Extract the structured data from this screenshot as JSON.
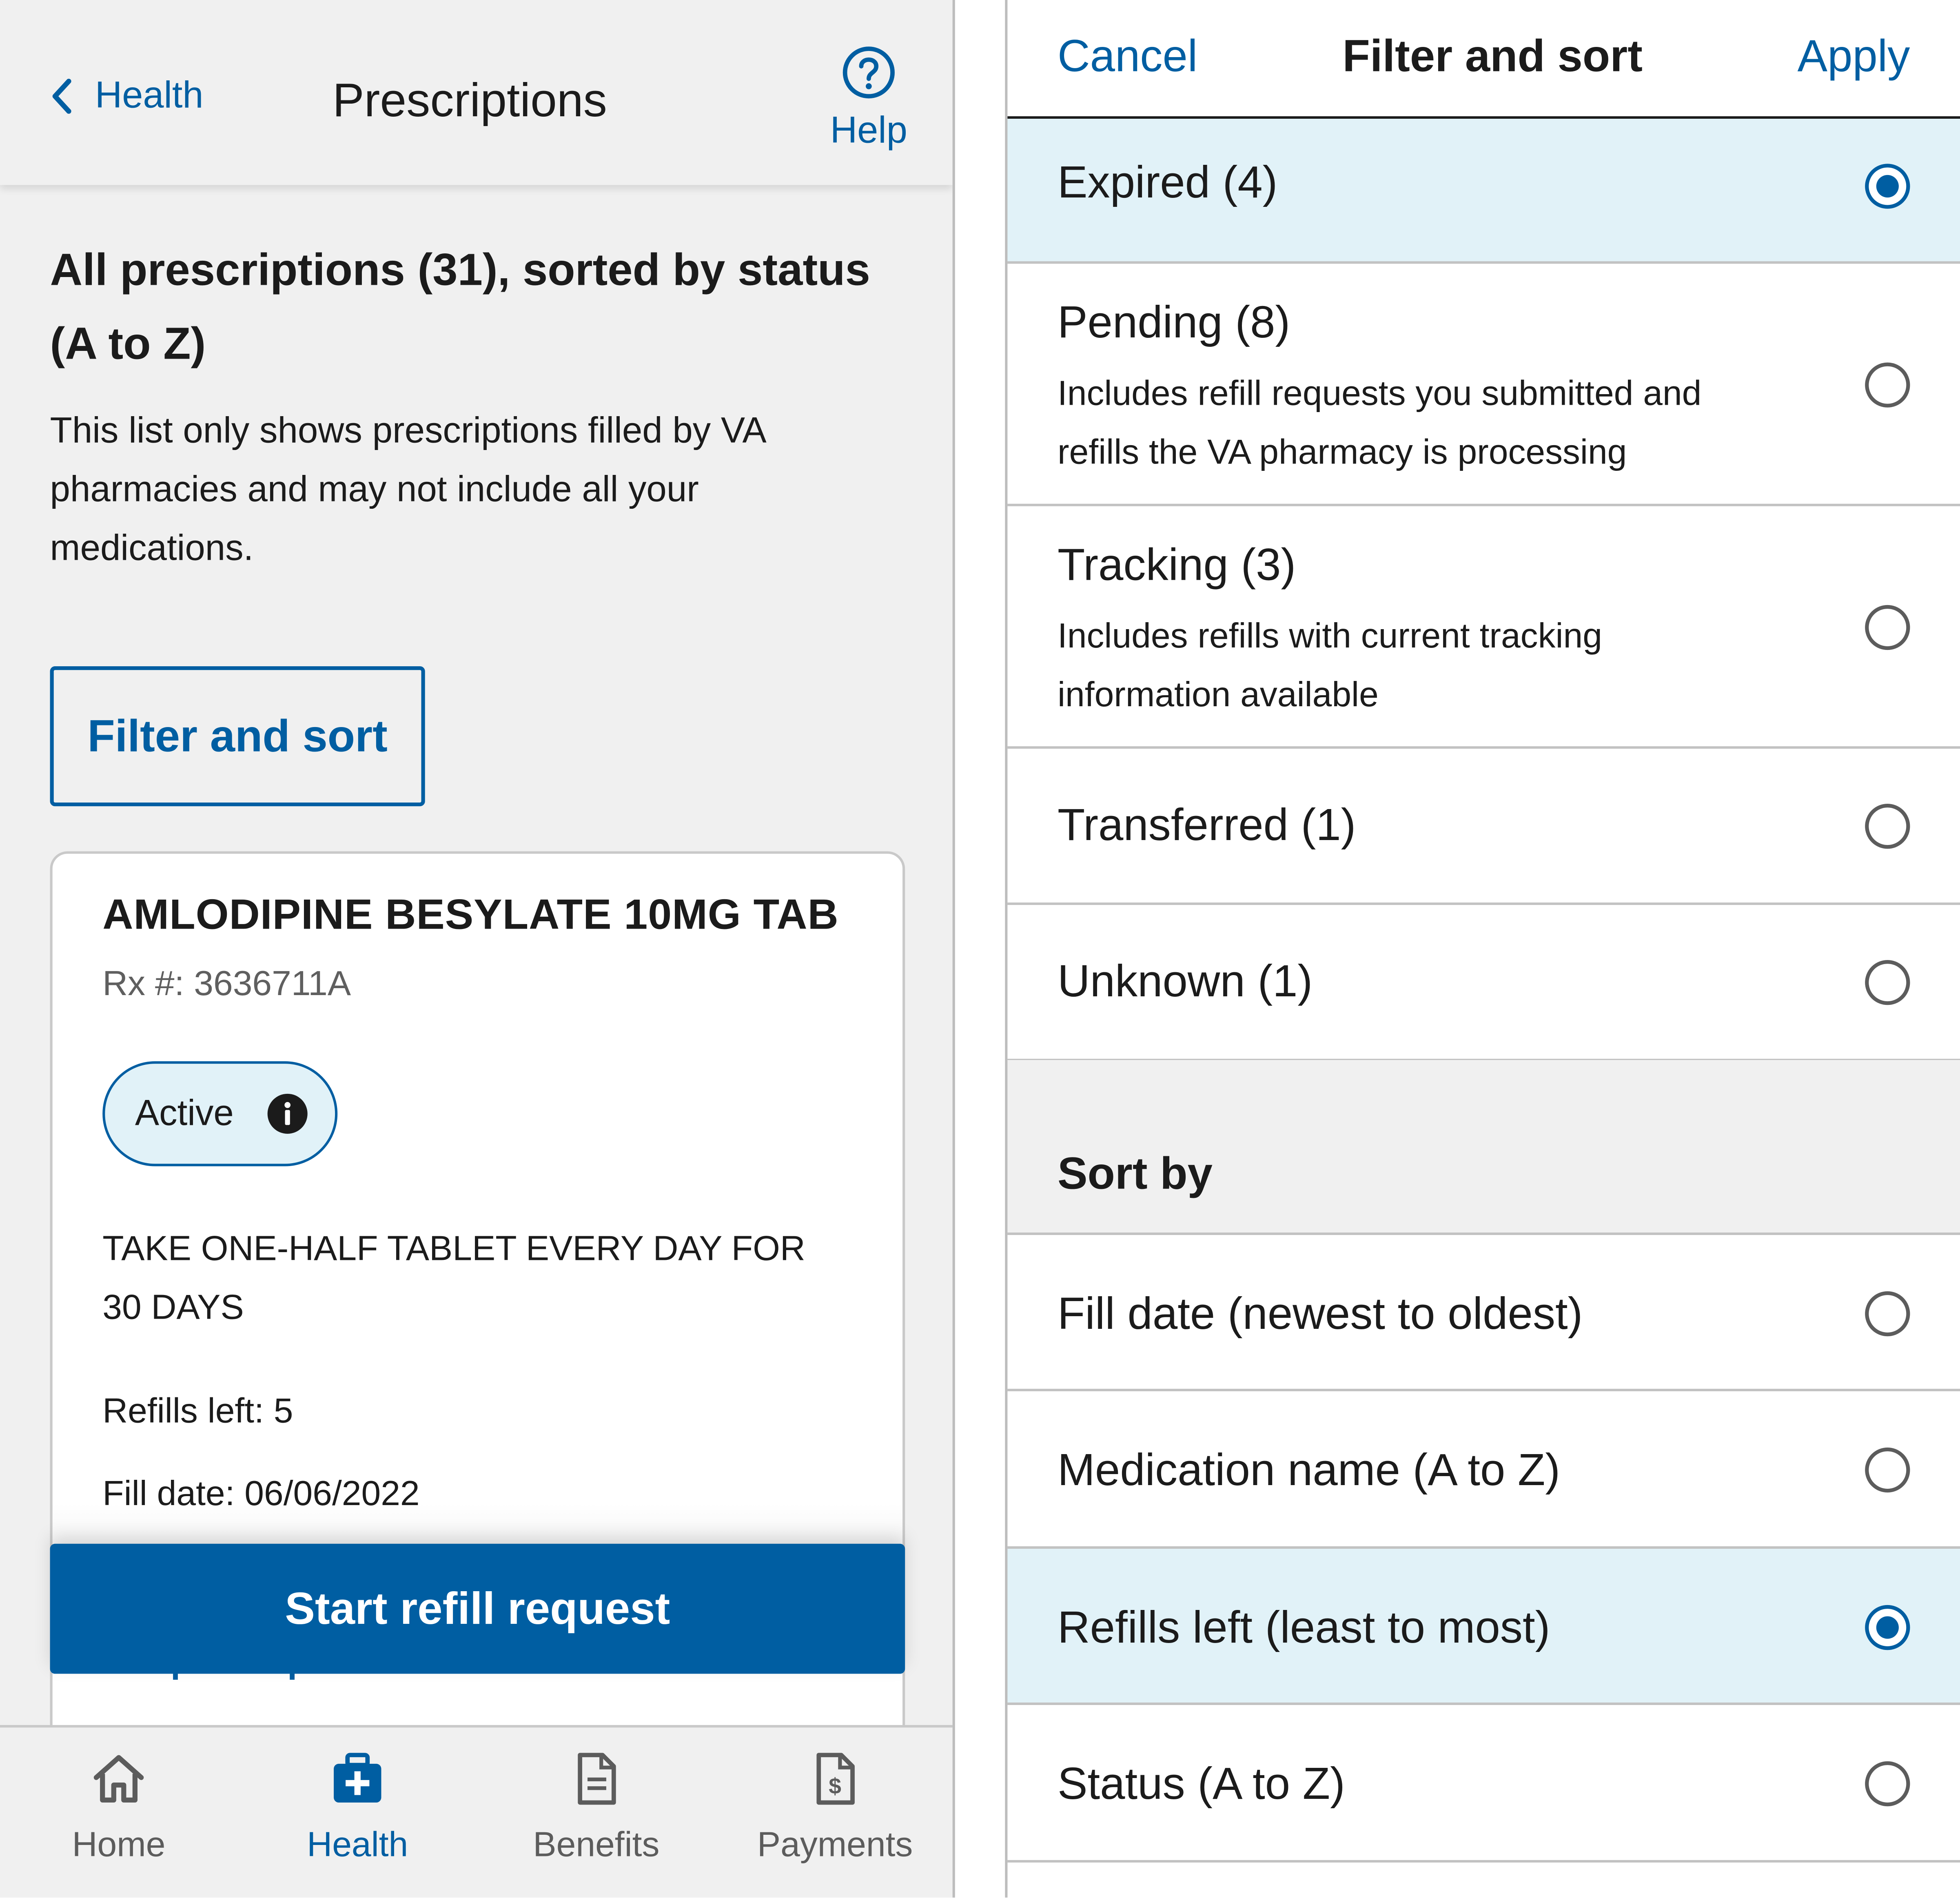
{
  "left": {
    "back_label": "Health",
    "page_title": "Prescriptions",
    "help_label": "Help",
    "heading": "All prescriptions (31), sorted by status (A to Z)",
    "info_text": "This list only shows prescriptions filled by VA pharmacies and may not include all your medications.",
    "filter_button": "Filter and sort",
    "card": {
      "med_name": "AMLODIPINE BESYLATE 10MG TAB",
      "rx": "Rx #: 3636711A",
      "status": "Active",
      "instructions": "TAKE ONE-HALF TABLET EVERY DAY FOR 30 DAYS",
      "refills": "Refills left: 5",
      "fill_date": "Fill date: 06/06/2022",
      "details_link": "Get prescription details"
    },
    "refill_button": "Start refill request",
    "tabs": [
      {
        "label": "Home",
        "icon": "home-icon",
        "active": false
      },
      {
        "label": "Health",
        "icon": "medkit-icon",
        "active": true
      },
      {
        "label": "Benefits",
        "icon": "document-icon",
        "active": false
      },
      {
        "label": "Payments",
        "icon": "dollar-document-icon",
        "active": false
      }
    ]
  },
  "right": {
    "cancel": "Cancel",
    "title": "Filter and sort",
    "apply": "Apply",
    "filter_options": [
      {
        "label": "Expired (4)",
        "desc": "",
        "selected": true
      },
      {
        "label": "Pending (8)",
        "desc": "Includes refill requests you submitted and refills the VA pharmacy is processing",
        "selected": false
      },
      {
        "label": "Tracking (3)",
        "desc": "Includes refills with current tracking information available",
        "selected": false
      },
      {
        "label": "Transferred (1)",
        "desc": "",
        "selected": false
      },
      {
        "label": "Unknown (1)",
        "desc": "",
        "selected": false
      }
    ],
    "sort_title": "Sort by",
    "sort_options": [
      {
        "label": "Fill date (newest to oldest)",
        "selected": false
      },
      {
        "label": "Medication name (A to Z)",
        "selected": false
      },
      {
        "label": "Refills left (least to most)",
        "selected": true
      },
      {
        "label": "Status (A to Z)",
        "selected": false
      }
    ]
  },
  "colors": {
    "primary": "#005ea2",
    "selected_bg": "#e1f2f8",
    "page_bg": "#f0f0f0",
    "text": "#1b1b1b"
  }
}
